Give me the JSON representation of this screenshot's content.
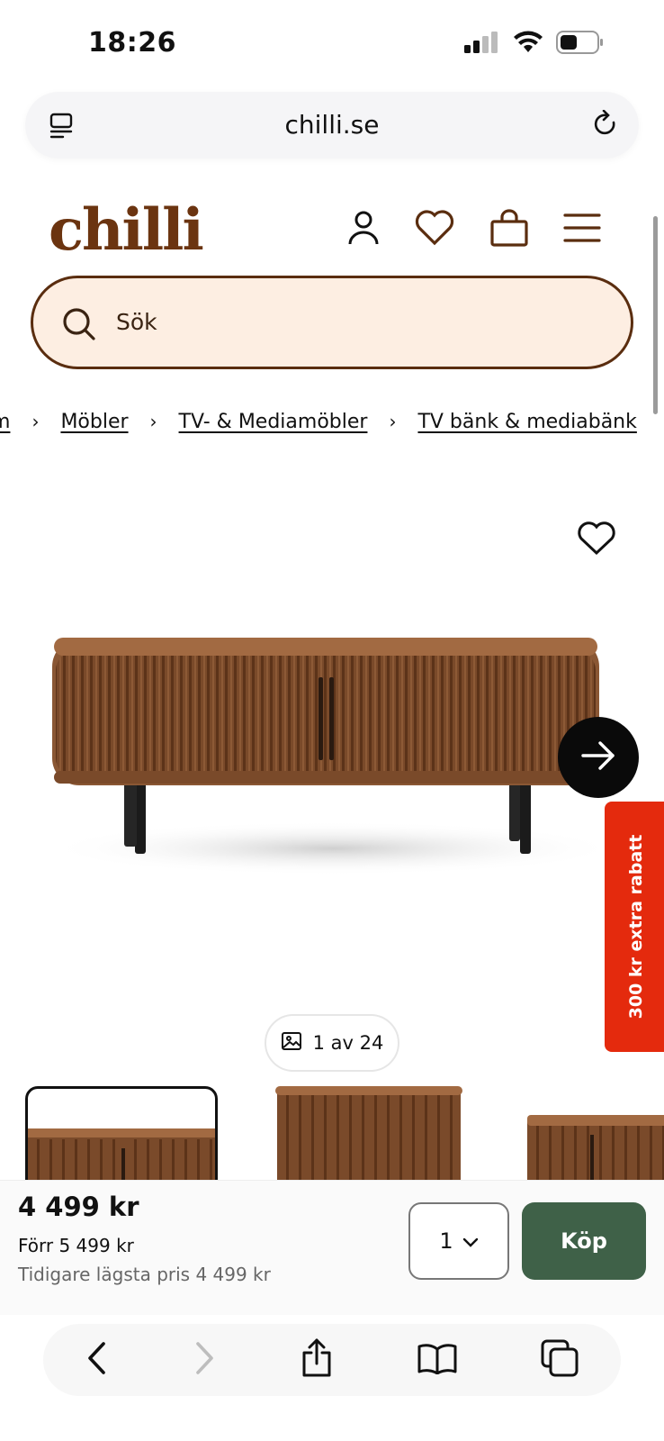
{
  "status_bar": {
    "time": "18:26"
  },
  "browser": {
    "url": "chilli.se"
  },
  "site": {
    "logo": "chilli",
    "colors": {
      "brand": "#6b3410",
      "search_bg": "#fdeee2",
      "buy": "#3f6148",
      "promo": "#e42a0d"
    }
  },
  "search": {
    "placeholder": "Sök"
  },
  "breadcrumb": [
    {
      "label": "m"
    },
    {
      "label": "Möbler"
    },
    {
      "label": "TV- & Mediamöbler"
    },
    {
      "label": "TV bänk & mediabänk"
    }
  ],
  "product": {
    "image_counter": "1 av 24",
    "promo": "300 kr extra rabatt",
    "price": "4 499 kr",
    "price_before": "Förr 5 499 kr",
    "lowest_price": "Tidigare lägsta pris 4 499 kr",
    "quantity": "1",
    "buy_label": "Köp"
  },
  "icons": {
    "header": [
      "account-icon",
      "heart-icon",
      "cart-icon",
      "menu-icon"
    ],
    "toolbar": [
      "back-icon",
      "forward-icon",
      "share-icon",
      "bookmarks-icon",
      "tabs-icon"
    ]
  }
}
